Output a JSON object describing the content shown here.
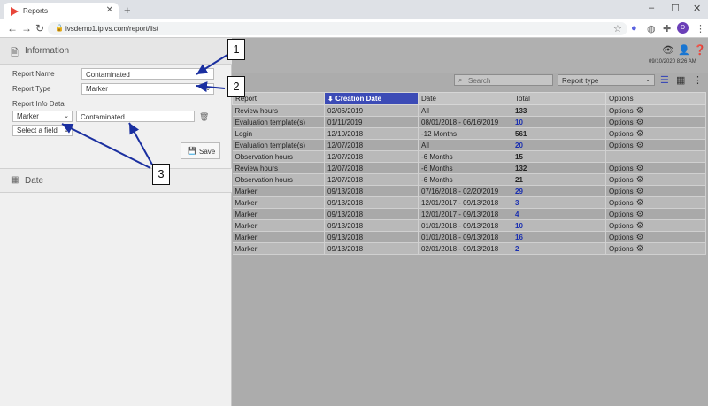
{
  "browser": {
    "tab_title": "Reports",
    "url": "ivsdemo1.ipivs.com/report/list",
    "profile_initial": "D"
  },
  "left": {
    "info_title": "Information",
    "report_name_label": "Report Name",
    "report_name_value": "Contaminated",
    "report_type_label": "Report Type",
    "report_type_value": "Marker",
    "report_info_label": "Report Info Data",
    "field_select_value": "Marker",
    "field_value": "Contaminated",
    "select_field_placeholder": "Select a field",
    "save_label": "Save",
    "date_title": "Date"
  },
  "toolbar": {
    "timestamp": "09/10/2020 8:26 AM",
    "search_placeholder": "Search",
    "report_type_select": "Report type"
  },
  "table": {
    "headers": [
      "Report",
      "Creation Date",
      "Date",
      "Total",
      "Options"
    ],
    "rows": [
      {
        "report": "Review hours",
        "created": "02/06/2019",
        "date": "All",
        "total": "133",
        "link": false,
        "options": "Options"
      },
      {
        "report": "Evaluation template(s)",
        "created": "01/11/2019",
        "date": "08/01/2018 - 06/16/2019",
        "total": "10",
        "link": true,
        "options": "Options"
      },
      {
        "report": "Login",
        "created": "12/10/2018",
        "date": "-12 Months",
        "total": "561",
        "link": false,
        "options": "Options"
      },
      {
        "report": "Evaluation template(s)",
        "created": "12/07/2018",
        "date": "All",
        "total": "20",
        "link": true,
        "options": "Options"
      },
      {
        "report": "Observation hours",
        "created": "12/07/2018",
        "date": "-6 Months",
        "total": "15",
        "link": false,
        "options": ""
      },
      {
        "report": "Review hours",
        "created": "12/07/2018",
        "date": "-6 Months",
        "total": "132",
        "link": false,
        "options": "Options"
      },
      {
        "report": "Observation hours",
        "created": "12/07/2018",
        "date": "-6 Months",
        "total": "21",
        "link": false,
        "options": "Options"
      },
      {
        "report": "Marker",
        "created": "09/13/2018",
        "date": "07/16/2018 - 02/20/2019",
        "total": "29",
        "link": true,
        "options": "Options"
      },
      {
        "report": "Marker",
        "created": "09/13/2018",
        "date": "12/01/2017 - 09/13/2018",
        "total": "3",
        "link": true,
        "options": "Options"
      },
      {
        "report": "Marker",
        "created": "09/13/2018",
        "date": "12/01/2017 - 09/13/2018",
        "total": "4",
        "link": true,
        "options": "Options"
      },
      {
        "report": "Marker",
        "created": "09/13/2018",
        "date": "01/01/2018 - 09/13/2018",
        "total": "10",
        "link": true,
        "options": "Options"
      },
      {
        "report": "Marker",
        "created": "09/13/2018",
        "date": "01/01/2018 - 09/13/2018",
        "total": "16",
        "link": true,
        "options": "Options"
      },
      {
        "report": "Marker",
        "created": "09/13/2018",
        "date": "02/01/2018 - 09/13/2018",
        "total": "2",
        "link": true,
        "options": "Options"
      }
    ]
  },
  "callouts": {
    "c1": "1",
    "c2": "2",
    "c3": "3"
  },
  "colors": {
    "accent": "#3c4bb6",
    "link": "#1a2fb0",
    "overlay": "#acacac"
  }
}
